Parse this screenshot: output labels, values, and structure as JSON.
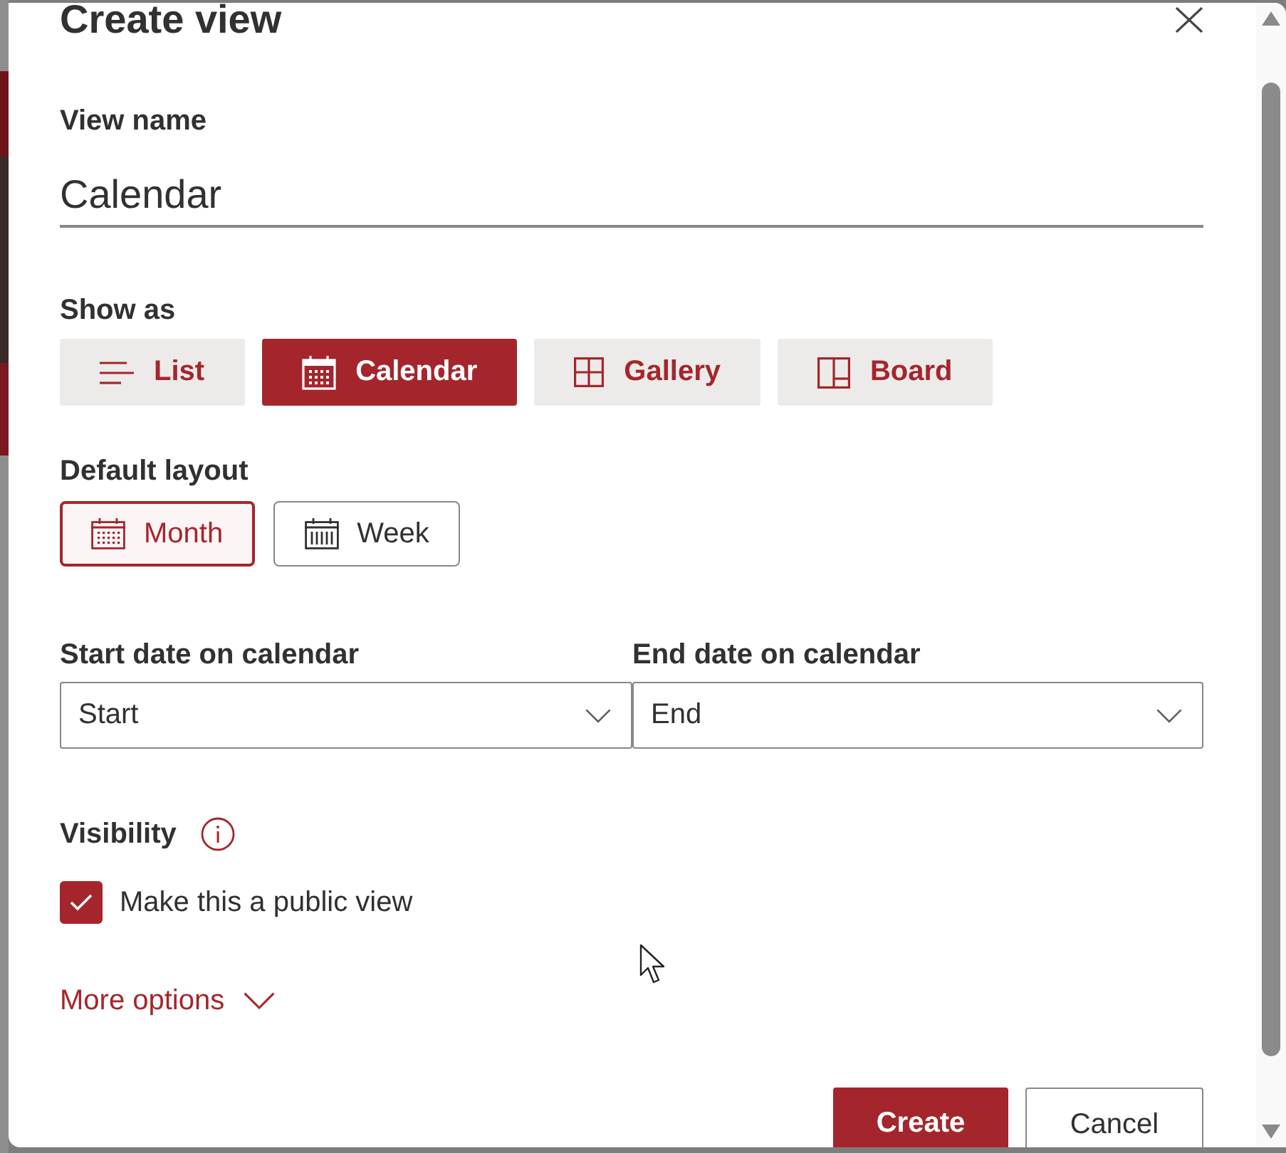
{
  "dialog": {
    "title": "Create view"
  },
  "view_name": {
    "label": "View name",
    "value": "Calendar"
  },
  "show_as": {
    "label": "Show as",
    "options": [
      {
        "label": "List",
        "kind": "list",
        "selected": false
      },
      {
        "label": "Calendar",
        "kind": "calendar",
        "selected": true
      },
      {
        "label": "Gallery",
        "kind": "gallery",
        "selected": false
      },
      {
        "label": "Board",
        "kind": "board",
        "selected": false
      }
    ]
  },
  "default_layout": {
    "label": "Default layout",
    "options": [
      {
        "label": "Month",
        "kind": "month",
        "selected": true
      },
      {
        "label": "Week",
        "kind": "week",
        "selected": false
      }
    ]
  },
  "date_fields": [
    {
      "label": "Start date on calendar",
      "value": "Start"
    },
    {
      "label": "End date on calendar",
      "value": "End"
    }
  ],
  "visibility": {
    "label": "Visibility",
    "checkbox": {
      "label": "Make this a public view",
      "checked": true
    }
  },
  "more_options": {
    "label": "More options",
    "expanded": false
  },
  "buttons": [
    {
      "label": "Create",
      "kind": "primary"
    },
    {
      "label": "Cancel",
      "kind": "secondary"
    }
  ]
}
